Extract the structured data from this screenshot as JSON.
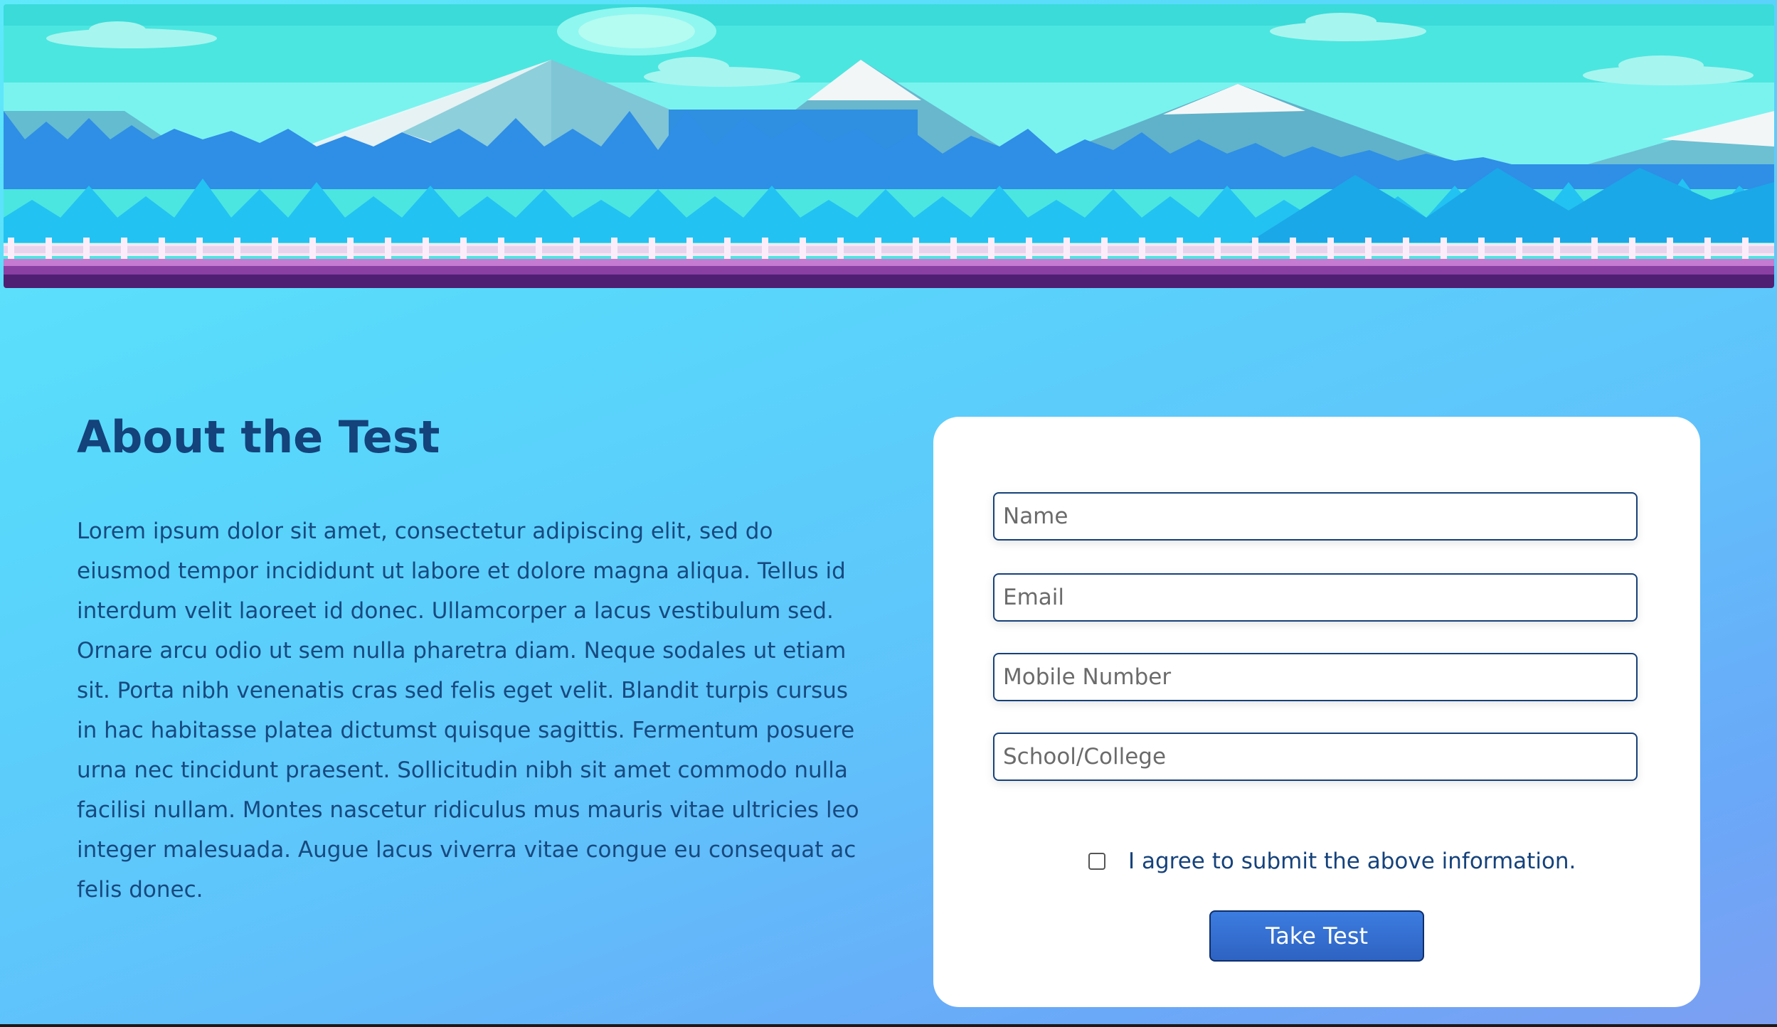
{
  "colors": {
    "heading": "#14427a",
    "body_text": "#17497f",
    "field_border": "#16417a",
    "button_bg": "#3370d2",
    "card_bg": "#ffffff"
  },
  "hero": {
    "banner_icon": "mountain-landscape-banner"
  },
  "about": {
    "title": "About the Test",
    "body": "Lorem ipsum dolor sit amet, consectetur adipiscing elit, sed do eiusmod tempor incididunt ut labore et dolore magna aliqua. Tellus id interdum velit laoreet id donec. Ullamcorper a lacus vestibulum sed. Ornare arcu odio ut sem nulla pharetra diam. Neque sodales ut etiam sit. Porta nibh venenatis cras sed felis eget velit. Blandit turpis cursus in hac habitasse platea dictumst quisque sagittis. Fermentum posuere urna nec tincidunt praesent. Sollicitudin nibh sit amet commodo nulla facilisi nullam. Montes nascetur ridiculus mus mauris vitae ultricies leo integer malesuada. Augue lacus viverra vitae congue eu consequat ac felis donec."
  },
  "form": {
    "name_placeholder": "Name",
    "name_value": "",
    "email_placeholder": "Email",
    "email_value": "",
    "mobile_placeholder": "Mobile Number",
    "mobile_value": "",
    "school_placeholder": "School/College",
    "school_value": "",
    "agree_label": "I agree to submit the above information.",
    "agree_checked": false,
    "submit_label": "Take Test"
  }
}
